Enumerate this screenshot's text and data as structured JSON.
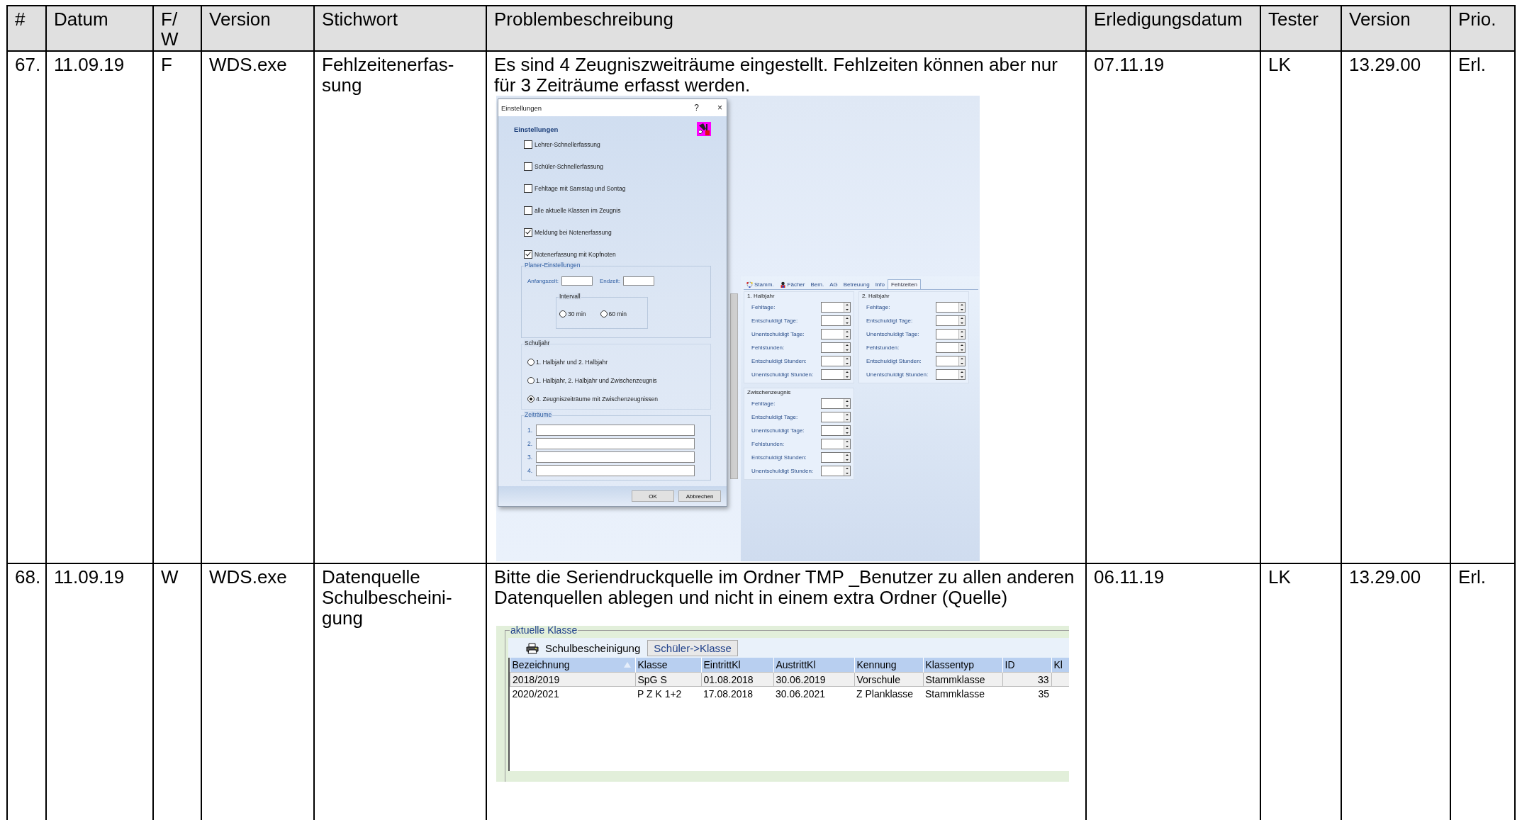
{
  "table": {
    "columns": [
      "#",
      "Datum",
      "F/ W",
      "Version",
      "Stichwort",
      "Problembeschreibung",
      "Erledigungsdatum",
      "Tester",
      "Version",
      "Prio."
    ],
    "rows": [
      {
        "number": "67.",
        "date": "11.09.19",
        "type": "F",
        "version": "WDS.exe",
        "keyword": "Fehlzeitenerfas-sung",
        "description": "Es sind 4 Zeugniszweiträume eingestellt. Fehlzeiten können aber nur für 3 Zeiträume erfasst werden.",
        "completion_date": "07.11.19",
        "tester": "LK",
        "fixed_version": "13.29.00",
        "priority": "Erl.",
        "screenshot": {
          "kind": "settings",
          "dialog": {
            "title": "Einstellungen",
            "help": "?",
            "close": "×",
            "heading": "Einstellungen",
            "checkboxes": [
              {
                "label": "Lehrer-Schnellerfassung",
                "checked": false
              },
              {
                "label": "Schüler-Schnellerfassung",
                "checked": false
              },
              {
                "label": "Fehltage mit Samstag und Sontag",
                "checked": false
              },
              {
                "label": "alle aktuelle Klassen im Zeugnis",
                "checked": false
              },
              {
                "label": "Meldung bei Notenerfassung",
                "checked": true
              },
              {
                "label": "Notenerfassung mit Kopfnoten",
                "checked": true
              }
            ],
            "planer": {
              "title": "Planer-Einstellungen",
              "start_label": "Anfangszeit:",
              "end_label": "Endzeit:",
              "interval_title": "Intervall",
              "intervals": [
                {
                  "label": "30 min",
                  "selected": false
                },
                {
                  "label": "60 min",
                  "selected": false
                }
              ]
            },
            "school_year": {
              "title": "Schuljahr",
              "options": [
                {
                  "label": "1. Halbjahr und 2. Halbjahr",
                  "selected": false
                },
                {
                  "label": "1. Halbjahr, 2. Halbjahr und Zwischenzeugnis",
                  "selected": false
                },
                {
                  "label": "4. Zeugniszeiträume mit Zwischenzeugnissen",
                  "selected": true
                }
              ]
            },
            "periods": {
              "title": "Zeiträume",
              "labels": [
                "1.",
                "2.",
                "3.",
                "4."
              ]
            },
            "buttons": [
              "OK",
              "Abbrechen"
            ]
          },
          "panel": {
            "tabs": [
              {
                "label": "Stamm.",
                "selected": false
              },
              {
                "label": "Fächer",
                "selected": false
              },
              {
                "label": "Bem.",
                "selected": false
              },
              {
                "label": "AG",
                "selected": false
              },
              {
                "label": "Betreuung",
                "selected": false
              },
              {
                "label": "Info",
                "selected": false
              },
              {
                "label": "Fehlzeiten",
                "selected": true
              }
            ],
            "groups": [
              {
                "title": "1. Halbjahr",
                "fields": [
                  "Fehltage:",
                  "Entschuldigt Tage:",
                  "Unentschuldigt Tage:",
                  "Fehlstunden:",
                  "Entschuldigt Stunden:",
                  "Unentschuldigt Stunden:"
                ]
              },
              {
                "title": "2. Halbjahr",
                "fields": [
                  "Fehltage:",
                  "Entschuldigt Tage:",
                  "Unentschuldigt Tage:",
                  "Fehlstunden:",
                  "Entschuldigt Stunden:",
                  "Unentschuldigt Stunden:"
                ]
              },
              {
                "title": "Zwischenzeugnis",
                "fields": [
                  "Fehltage:",
                  "Entschuldigt Tage:",
                  "Unentschuldigt Tage:",
                  "Fehlstunden:",
                  "Entschuldigt Stunden:",
                  "Unentschuldigt Stunden:"
                ]
              }
            ]
          }
        }
      },
      {
        "number": "68.",
        "date": "11.09.19",
        "type": "W",
        "version": "WDS.exe",
        "keyword": "Datenquelle Schulbescheini-gung",
        "description": "Bitte die Seriendruckquelle im Ordner TMP _Benutzer zu allen anderen Datenquellen ablegen und nicht in einem extra Ordner (Quelle)",
        "completion_date": "06.11.19",
        "tester": "LK",
        "fixed_version": "13.29.00",
        "priority": "Erl.",
        "screenshot": {
          "kind": "class_list",
          "group_title": "aktuelle Klasse",
          "print_button": "Schulbescheinigung",
          "move_button": "Schüler->Klasse",
          "columns": [
            {
              "label": "Bezeichnung",
              "sorted": true
            },
            {
              "label": "Klasse",
              "sorted": false
            },
            {
              "label": "EintrittKl",
              "sorted": false
            },
            {
              "label": "AustrittKl",
              "sorted": false
            },
            {
              "label": "Kennung",
              "sorted": false
            },
            {
              "label": "Klassentyp",
              "sorted": false
            },
            {
              "label": "ID",
              "sorted": false
            },
            {
              "label": "Kl",
              "sorted": false
            }
          ],
          "rows": [
            [
              "2018/2019",
              "SpG S",
              "01.08.2018",
              "30.06.2019",
              "Vorschule",
              "Stammklasse",
              "33",
              ""
            ],
            [
              "2020/2021",
              "P Z K 1+2",
              "17.08.2018",
              "30.06.2021",
              "Z Planklasse",
              "Stammklasse",
              "35",
              ""
            ]
          ]
        }
      }
    ]
  }
}
